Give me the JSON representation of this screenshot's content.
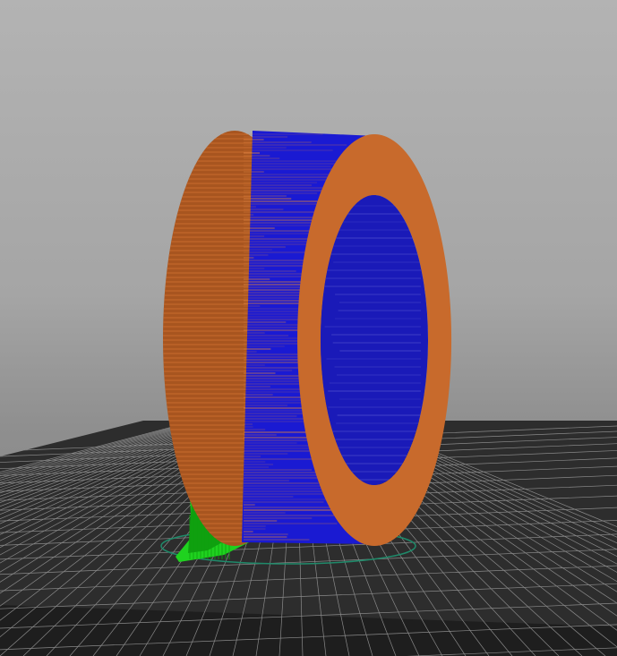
{
  "viewport": {
    "background_top": "#b3b3b3",
    "background_bottom": "#7e7e7e"
  },
  "print_bed": {
    "surface_color": "#2d2d2d",
    "grid_color": "#8a8a8a",
    "edge_color": "#1e1e1e"
  },
  "model": {
    "shape": "ring",
    "orientation": "standing-on-edge",
    "face_color": "#c86a2c",
    "face_shade_color": "#a8551f",
    "body_color": "#1a1ad2",
    "inner_color": "#1a1ab8",
    "seam_line_color": "#d9803f"
  },
  "supports": {
    "color": "#1fd21f",
    "shade_color": "#0fa00f"
  },
  "brim_outline": {
    "color": "#1f8a6a"
  }
}
